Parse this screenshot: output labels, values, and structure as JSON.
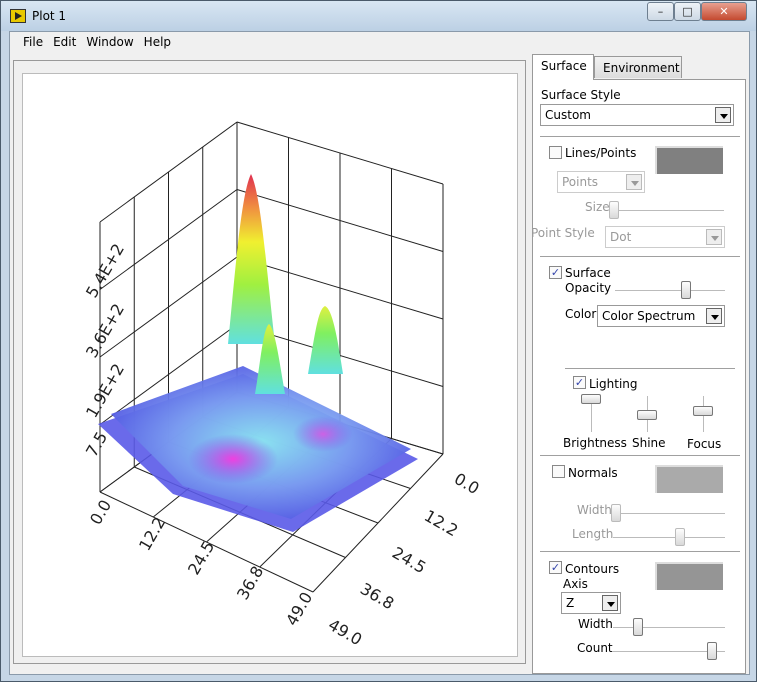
{
  "window": {
    "title": "Plot 1",
    "minimize": "–",
    "maximize": "□",
    "close": "✕"
  },
  "menu": [
    "File",
    "Edit",
    "Window",
    "Help"
  ],
  "plot": {
    "z_ticks": [
      "7.5",
      "1.9E+2",
      "3.6E+2",
      "5.4E+2"
    ],
    "x_ticks": [
      "0.0",
      "12.2",
      "24.5",
      "36.8",
      "49.0"
    ],
    "y_ticks": [
      "0.0",
      "12.2",
      "24.5",
      "36.8",
      "49.0"
    ],
    "colormap": "Color Spectrum"
  },
  "panel": {
    "tabs": [
      "Surface",
      "Environment"
    ],
    "active_tab": "Surface",
    "surface_style_label": "Surface Style",
    "surface_style_value": "Custom",
    "lines_points": {
      "label": "Lines/Points",
      "checked": false,
      "mode": "Points",
      "size_label": "Size",
      "size_value": 0,
      "point_style_label": "Point Style",
      "point_style_value": "Dot",
      "color": "#808080"
    },
    "surface": {
      "label": "Surface",
      "checked": true,
      "opacity_label": "Opacity",
      "opacity_value": 0.75,
      "color_label": "Color",
      "color_value": "Color Spectrum"
    },
    "lighting": {
      "label": "Lighting",
      "checked": true,
      "brightness_label": "Brightness",
      "shine_label": "Shine",
      "focus_label": "Focus",
      "brightness_value": 1.0,
      "shine_value": 0.5,
      "focus_value": 0.6
    },
    "normals": {
      "label": "Normals",
      "checked": false,
      "width_label": "Width",
      "length_label": "Length",
      "width_value": 0,
      "length_value": 0.6,
      "color": "#aaaaaa"
    },
    "contours": {
      "label": "Contours",
      "checked": true,
      "axis_label": "Axis",
      "axis_value": "Z",
      "width_label": "Width",
      "count_label": "Count",
      "width_value": 0.2,
      "count_value": 0.95,
      "color": "#959595"
    }
  }
}
